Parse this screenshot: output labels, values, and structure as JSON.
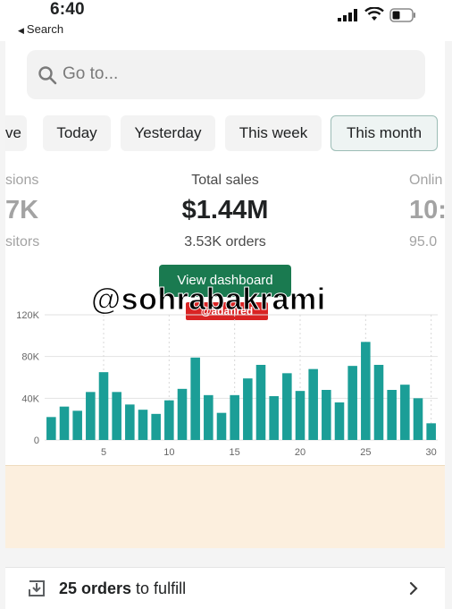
{
  "status_bar": {
    "time": "6:40",
    "back_label": "Search"
  },
  "search": {
    "placeholder": "Go to..."
  },
  "tabs": [
    {
      "label": "ve",
      "active": false
    },
    {
      "label": "Today",
      "active": false
    },
    {
      "label": "Yesterday",
      "active": false
    },
    {
      "label": "This week",
      "active": false
    },
    {
      "label": "This month",
      "active": true
    }
  ],
  "metrics": {
    "left": {
      "label": "sions",
      "value": "7K",
      "sub": "sitors"
    },
    "center": {
      "label": "Total sales",
      "value": "$1.44M",
      "sub": "3.53K orders"
    },
    "right": {
      "label": "Onlin",
      "value": "10:",
      "sub": "95.0"
    }
  },
  "dashboard_button": {
    "label": "View dashboard"
  },
  "overlay": {
    "watermark": "@sohrabakrami",
    "badge": "@adafired"
  },
  "colors": {
    "bar": "#1b9e97",
    "button": "#1a7a50",
    "active_tab_border": "#9cbdb6",
    "banner": "#fcefde",
    "badge": "#d92424"
  },
  "chart_data": {
    "type": "bar",
    "x": [
      1,
      2,
      3,
      4,
      5,
      6,
      7,
      8,
      9,
      10,
      11,
      12,
      13,
      14,
      15,
      16,
      17,
      18,
      19,
      20,
      21,
      22,
      23,
      24,
      25,
      26,
      27,
      28,
      29,
      30
    ],
    "values": [
      22000,
      32000,
      28000,
      46000,
      65000,
      46000,
      34000,
      29000,
      25000,
      38000,
      49000,
      79000,
      43000,
      26000,
      43000,
      59000,
      72000,
      42000,
      64000,
      47000,
      68000,
      48000,
      36000,
      71000,
      94000,
      72000,
      48000,
      53000,
      40000,
      16000
    ],
    "ylim": [
      0,
      120000
    ],
    "y_ticks": [
      0,
      40000,
      80000,
      120000
    ],
    "y_tick_labels": [
      "0",
      "40K",
      "80K",
      "120K"
    ],
    "x_ticks": [
      5,
      10,
      15,
      20,
      25,
      30
    ],
    "x_tick_labels": [
      "5",
      "10",
      "15",
      "20",
      "25",
      "30"
    ],
    "grid": true
  },
  "fulfill": {
    "count": "25 orders",
    "suffix": " to fulfill"
  },
  "icons": {
    "search": "search-icon",
    "fulfill": "download-box-icon",
    "chevron": "chevron-right-icon"
  }
}
